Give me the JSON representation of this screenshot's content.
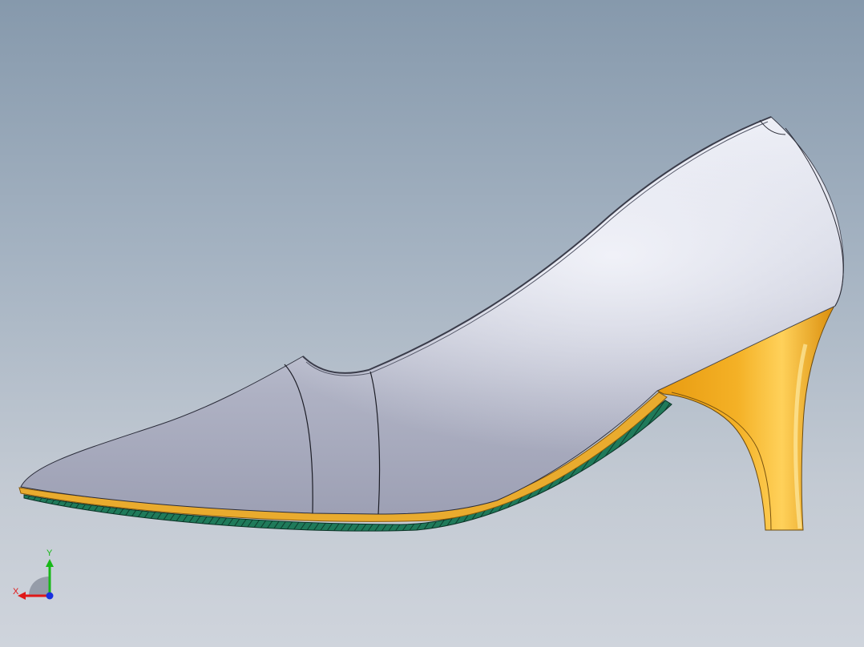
{
  "viewport": {
    "background_top": "#8699ac",
    "background_bottom": "#cfd4dc"
  },
  "model": {
    "upper_color": "#c5c7d6",
    "heel_color": "#f0a818",
    "sole_color": "#1f7a5a",
    "insole_color": "#e7a52a"
  },
  "triad": {
    "y_label": "Y",
    "x_label": "X",
    "y_color": "#18b818",
    "x_color": "#e01818",
    "z_color": "#1830e0"
  }
}
